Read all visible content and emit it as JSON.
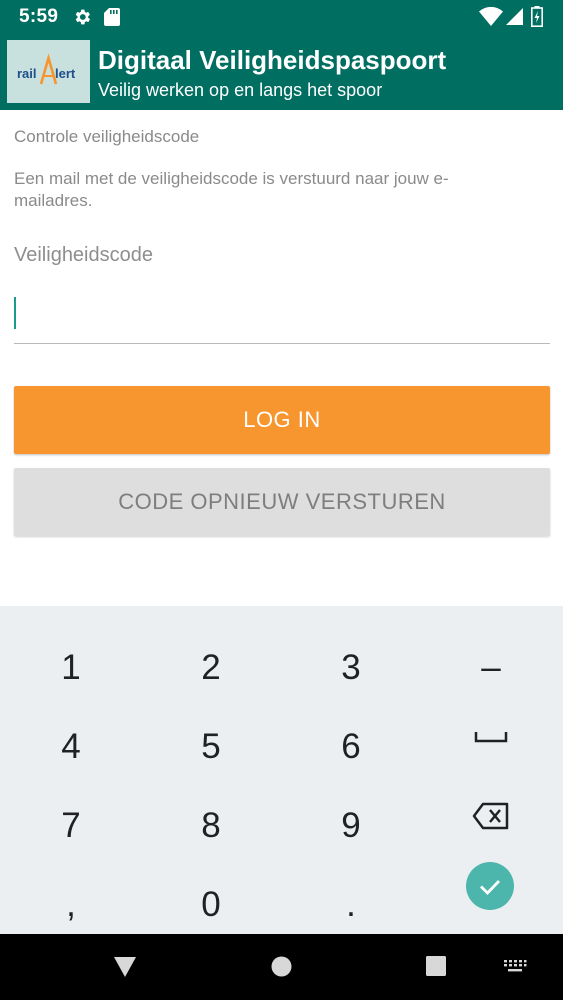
{
  "status_bar": {
    "time": "5:59",
    "icons": [
      "gear-icon",
      "sd-card-icon",
      "wifi-icon",
      "signal-icon",
      "battery-icon"
    ]
  },
  "app_bar": {
    "logo_text": "railAlert",
    "title": "Digitaal Veiligheidspaspoort",
    "subtitle": "Veilig werken op en langs het spoor"
  },
  "main": {
    "section_title": "Controle veiligheidscode",
    "info": "Een mail met de veiligheidscode is verstuurd naar jouw e-mailadres.",
    "field_label": "Veiligheidscode",
    "field_value": "",
    "login_label": "LOG IN",
    "resend_label": "CODE OPNIEUW VERSTUREN"
  },
  "keyboard": {
    "keys": [
      "1",
      "2",
      "3",
      "–",
      "4",
      "5",
      "6",
      "space",
      "7",
      "8",
      "9",
      "backspace",
      ",",
      "0",
      ".",
      "done"
    ]
  },
  "nav_bar": {
    "icons": [
      "back-icon",
      "home-icon",
      "recent-apps-icon",
      "keyboard-switch-icon"
    ]
  },
  "colors": {
    "primary": "#006e61",
    "accent": "#f7962e",
    "caret": "#1a9c8c",
    "done_key": "#4db6ac",
    "disabled_button": "#dedede"
  }
}
